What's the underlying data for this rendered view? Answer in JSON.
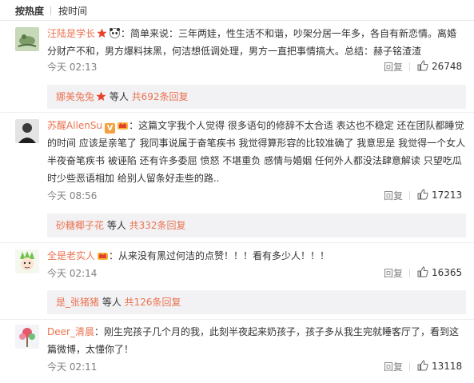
{
  "sort": {
    "hot_label": "按热度",
    "time_label": "按时间"
  },
  "comments": [
    {
      "user": "汪陆是学长",
      "text": "：简单来说：三年两娃，性生活不和谐，吵架分居一年多，各自有新恋情。离婚分财产不和，男方爆料抹黑，何洁想低调处理，男方一直把事情搞大。总结：赫子铭渣渣",
      "time": "今天 02:13",
      "reply_label": "回复",
      "likes": "26748",
      "sub_user": "娜美兔兔",
      "sub_mid": " 等人 ",
      "sub_more": "共692条回复"
    },
    {
      "user": "苏醒AllenSu",
      "text": "：这篇文字我个人觉得 很多语句的修辞不太合适 表达也不稳定 还在团队都睡觉的时间 应该是亲笔了 我同事说属于奋笔疾书 我觉得算形容的比较准确了 我意思是 我觉得一个女人半夜奋笔疾书 被诬陷 还有许多委屈 愤怒 不堪重负 感情与婚姻 任何外人都没法肆意解读 只望吃瓜时少些恶语相加 给别人留条好走些的路..",
      "time": "今天 08:56",
      "reply_label": "回复",
      "likes": "17213",
      "sub_user": "砂糖椰子花",
      "sub_mid": " 等人 ",
      "sub_more": "共332条回复"
    },
    {
      "user": "全是老实人",
      "text": "：从来没有黑过何洁的点赞！！！看有多少人！！！",
      "time": "今天 02:14",
      "reply_label": "回复",
      "likes": "16365",
      "sub_user": "是_张猪猪",
      "sub_mid": " 等人 ",
      "sub_more": "共126条回复"
    },
    {
      "user": "Deer_清晨",
      "text": "：刚生完孩子几个月的我，此刻半夜起来奶孩子，孩子多从我生完就睡客厅了，看到这篇微博，太懂你了！",
      "time": "今天 02:11",
      "reply_label": "回复",
      "likes": "13118"
    }
  ],
  "colors": {
    "username": "#eb7350",
    "muted": "#808080",
    "subbox": "#f2f2f5"
  }
}
